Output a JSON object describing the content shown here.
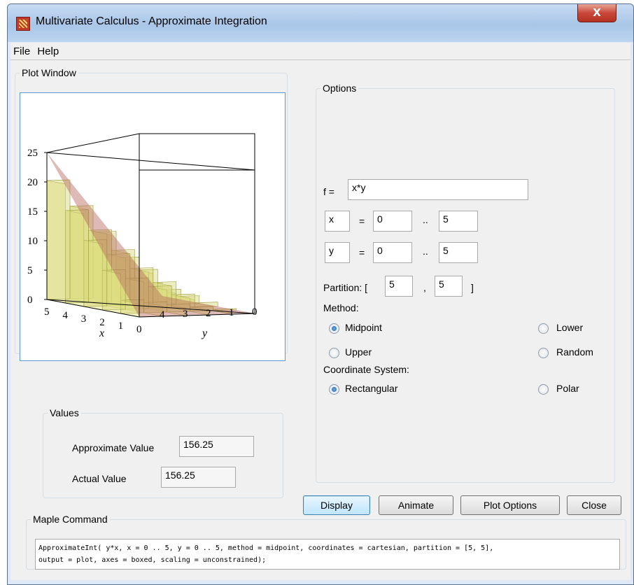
{
  "window": {
    "title": "Multivariate Calculus - Approximate Integration",
    "close_label": "X"
  },
  "menu": {
    "items": [
      "File",
      "Help"
    ]
  },
  "plot": {
    "legend": "Plot Window",
    "z_ticks": [
      "25",
      "20",
      "15",
      "10",
      "5",
      "0"
    ],
    "x_ticks": [
      "5",
      "4",
      "3",
      "2",
      "1",
      "0"
    ],
    "y_ticks": [
      "4",
      "3",
      "2",
      "1",
      "0"
    ],
    "x_axis_label": "x",
    "y_axis_label": "y"
  },
  "values": {
    "legend": "Values",
    "approx_label": "Approximate Value",
    "approx_value": "156.25",
    "actual_label": "Actual Value",
    "actual_value": "156.25"
  },
  "options": {
    "legend": "Options",
    "f_label": "f =",
    "f_value": "x*y",
    "x_var": "x",
    "x_lo": "0",
    "x_hi": "5",
    "y_var": "y",
    "y_lo": "0",
    "y_hi": "5",
    "eq": "=",
    "dots": "..",
    "partition_label": "Partition: [",
    "partition_x": "5",
    "partition_comma": ",",
    "partition_y": "5",
    "partition_close": "]",
    "method_label": "Method:",
    "methods": [
      "Midpoint",
      "Lower",
      "Upper",
      "Random"
    ],
    "method_selected": "Midpoint",
    "coord_label": "Coordinate System:",
    "coords": [
      "Rectangular",
      "Polar"
    ],
    "coord_selected": "Rectangular"
  },
  "buttons": {
    "display": "Display",
    "animate": "Animate",
    "plot_options": "Plot Options",
    "close": "Close"
  },
  "command": {
    "legend": "Maple Command",
    "line1": "ApproximateInt( y*x, x = 0 .. 5, y = 0 .. 5, method = midpoint, coordinates = cartesian, partition = [5, 5],",
    "line2": "output = plot, axes = boxed, scaling = unconstrained);"
  },
  "colors": {
    "accent": "#3c7fb1",
    "bars": "#e6e68a",
    "surface": "#b5655e"
  }
}
